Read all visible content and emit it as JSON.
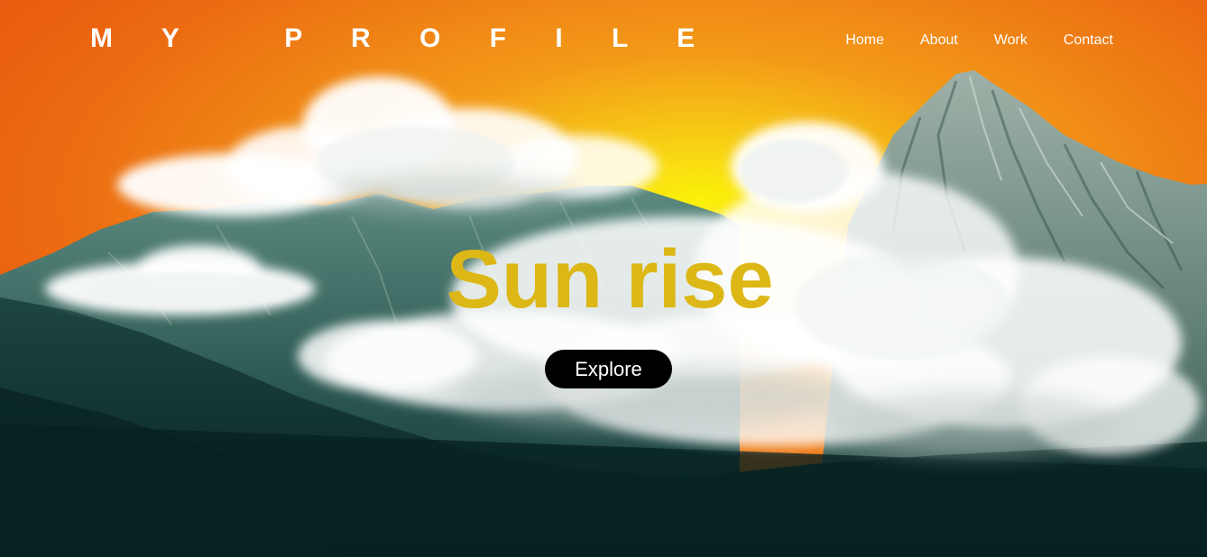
{
  "header": {
    "logo": "M Y   P R O F I L E",
    "nav": [
      "Home",
      "About",
      "Work",
      "Contact"
    ]
  },
  "hero": {
    "title": "Sun rise",
    "button_label": "Explore"
  },
  "colors": {
    "sky_top": "#ea5d0f",
    "sun_glow": "#f9ee0a",
    "title": "#dcb716",
    "button_bg": "#000000",
    "mountain_dark": "#0d2a2b",
    "mountain_mid": "#3e6b62",
    "snow": "#c9d3cf"
  }
}
